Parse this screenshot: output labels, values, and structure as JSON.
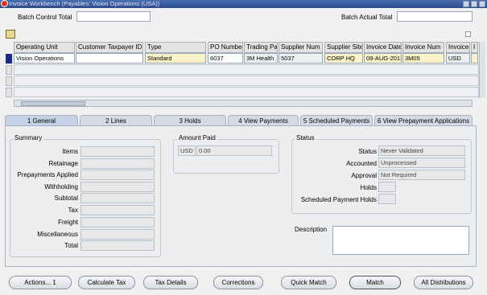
{
  "window": {
    "title": "Invoice Workbench (Payables: Vision Operations (USA))"
  },
  "batch": {
    "control_label": "Batch Control Total",
    "actual_label": "Batch Actual Total"
  },
  "grid": {
    "columns": [
      "Operating Unit",
      "Customer Taxpayer ID",
      "Type",
      "PO Number",
      "Trading Pa",
      "Supplier Num",
      "Supplier Site",
      "Invoice Date",
      "Invoice Num",
      "Invoice",
      "I"
    ],
    "row1": [
      "Vision Operations",
      "",
      "Standard",
      "6037",
      "3M Health",
      "5037",
      "CORP HQ",
      "09-AUG-2013",
      "3M05",
      "USD"
    ]
  },
  "tabs": [
    "1 General",
    "2 Lines",
    "3 Holds",
    "4 View Payments",
    "5 Scheduled Payments",
    "6 View Prepayment Applications"
  ],
  "summary": {
    "title": "Summary",
    "labels": [
      "Items",
      "Retainage",
      "Prepayments Applied",
      "Withholding",
      "Subtotal",
      "Tax",
      "Freight",
      "Miscellaneous",
      "Total"
    ]
  },
  "amount_paid": {
    "title": "Amount Paid",
    "currency": "USD",
    "value": "0.00"
  },
  "status": {
    "title": "Status",
    "status_label": "Status",
    "status_value": "Never Validated",
    "accounted_label": "Accounted",
    "accounted_value": "Unprocessed",
    "approval_label": "Approval",
    "approval_value": "Not Required",
    "holds_label": "Holds",
    "sched_holds_label": "Scheduled Payment Holds"
  },
  "description": {
    "label": "Description"
  },
  "buttons": [
    "Actions... 1",
    "Calculate Tax",
    "Tax Details",
    "Corrections",
    "Quick Match",
    "Match",
    "All Distributions"
  ]
}
